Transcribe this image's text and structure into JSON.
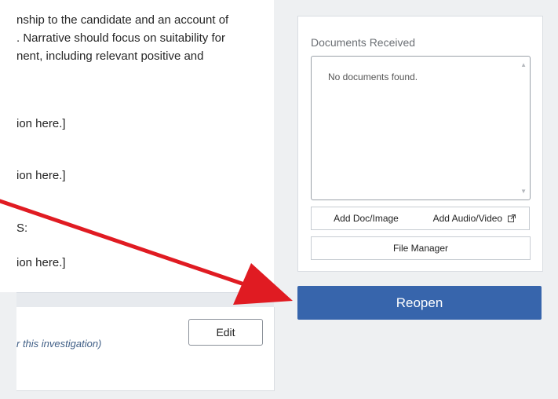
{
  "narrative": {
    "lines": [
      "nship to the candidate and an account of",
      ". Narrative should focus on suitability for",
      "nent, including relevant positive and"
    ],
    "placeholder_1": "ion here.]",
    "placeholder_2": "ion here.]",
    "section_fragment": "S:",
    "placeholder_3": "ion here.]"
  },
  "edit_card": {
    "edit_label": "Edit",
    "investigation_note": "r this investigation)"
  },
  "documents": {
    "label": "Documents Received",
    "empty_text": "No documents found.",
    "add_doc_label": "Add Doc/Image",
    "add_av_label": "Add Audio/Video",
    "file_manager_label": "File Manager"
  },
  "actions": {
    "reopen_label": "Reopen"
  },
  "colors": {
    "primary": "#3765ac",
    "arrow": "#e01b22"
  },
  "icons": {
    "external_link": "external-link-icon",
    "scroll_up": "scroll-up-icon",
    "scroll_down": "scroll-down-icon"
  }
}
